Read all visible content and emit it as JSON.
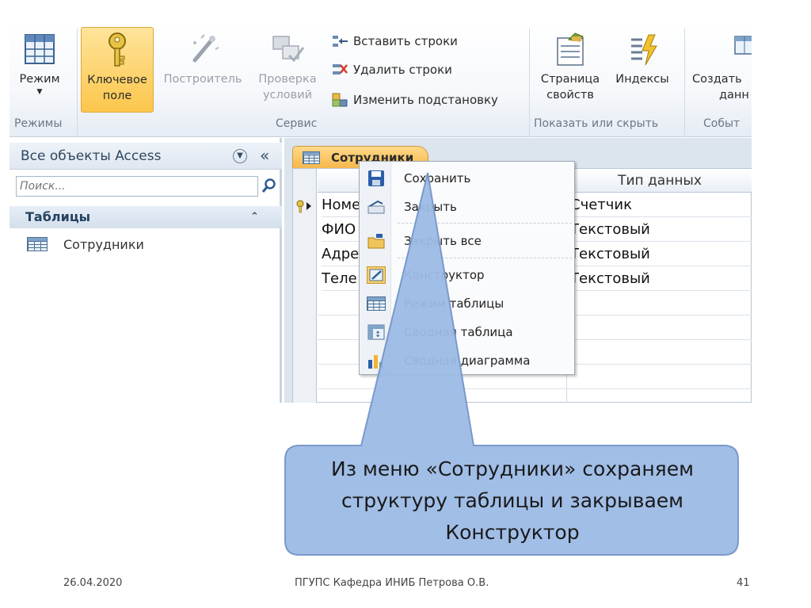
{
  "ribbon": {
    "btn_mode": "Режим",
    "btn_key_1": "Ключевое",
    "btn_key_2": "поле",
    "btn_builder": "Построитель",
    "btn_check_1": "Проверка",
    "btn_check_2": "условий",
    "cmd_insert_rows": "Вставить строки",
    "cmd_delete_rows": "Удалить строки",
    "cmd_change_lookup": "Изменить подстановку",
    "btn_props_1": "Страница",
    "btn_props_2": "свойств",
    "btn_indexes": "Индексы",
    "btn_create_1": "Создать",
    "btn_create_2": "данн",
    "group_modes": "Режимы",
    "group_service": "Сервис",
    "group_show_hide": "Показать или скрыть",
    "group_events": "Событ"
  },
  "nav": {
    "header": "Все объекты Access",
    "search_placeholder": "Поиск...",
    "group": "Таблицы",
    "item": "Сотрудники"
  },
  "doc": {
    "tab": "Сотрудники",
    "col_type_header": "Тип данных",
    "rows": [
      {
        "field": "Номе",
        "type": "Счетчик"
      },
      {
        "field": "ФИО",
        "type": "Текстовый"
      },
      {
        "field": "Адре",
        "type": "Текстовый"
      },
      {
        "field": "Теле",
        "type": "Текстовый"
      }
    ]
  },
  "context_menu": {
    "items": [
      "Сохранить",
      "Закрыть",
      "Закрыть все",
      "Конструктор",
      "Режим таблицы",
      "Сводная таблица",
      "Сводная диаграмма"
    ]
  },
  "callout": {
    "text": "Из меню «Сотрудники»  сохраняем структуру таблицы и закрываем Конструктор"
  },
  "footer": {
    "date": "26.04.2020",
    "center": "ПГУПС  Кафедра  ИНИБ  Петрова О.В.",
    "page": "41"
  },
  "colors": {
    "callout_fill": "#9dbbe6",
    "callout_stroke": "#7394c8",
    "tab_fill": "#f6b84c",
    "selected_button": "#fbc64c"
  }
}
